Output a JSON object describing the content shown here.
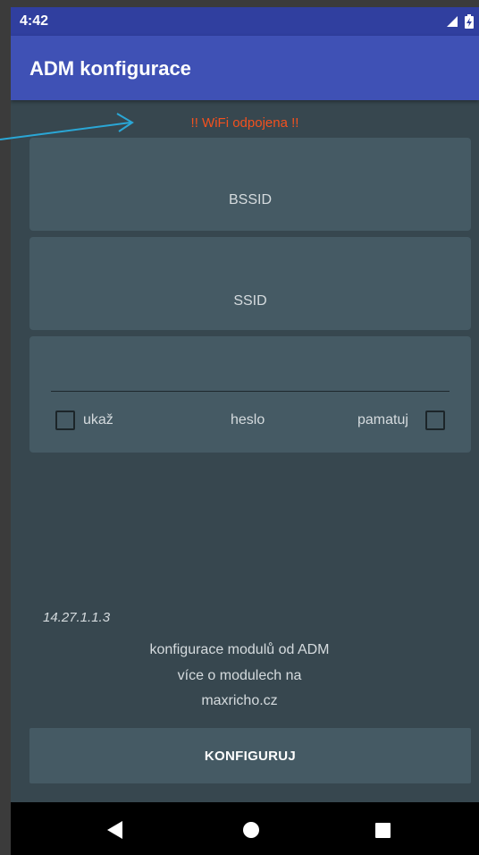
{
  "status_bar": {
    "time": "4:42",
    "signal_icon": "signal-icon",
    "battery_icon": "battery-icon"
  },
  "app_bar": {
    "title": "ADM konfigurace"
  },
  "warning": {
    "text": "!! WiFi odpojena !!",
    "color": "#f4511e"
  },
  "fields": {
    "bssid_label": "BSSID",
    "ssid_label": "SSID",
    "password_label": "heslo",
    "show_label": "ukaž",
    "remember_label": "pamatuj"
  },
  "footer": {
    "version": "14.27.1.1.3",
    "info_line1": "konfigurace modulů od ADM",
    "info_line2": "více o modulech na",
    "info_line3": "maxricho.cz"
  },
  "actions": {
    "configure_label": "KONFIGURUJ"
  },
  "nav": {
    "back_icon": "back-icon",
    "home_icon": "home-icon",
    "recents_icon": "recents-icon"
  },
  "colors": {
    "primary": "#3f51b5",
    "primary_dark": "#303f9f",
    "background": "#37474f",
    "card": "#455a64",
    "annotation_arrow": "#2aa7d6"
  }
}
